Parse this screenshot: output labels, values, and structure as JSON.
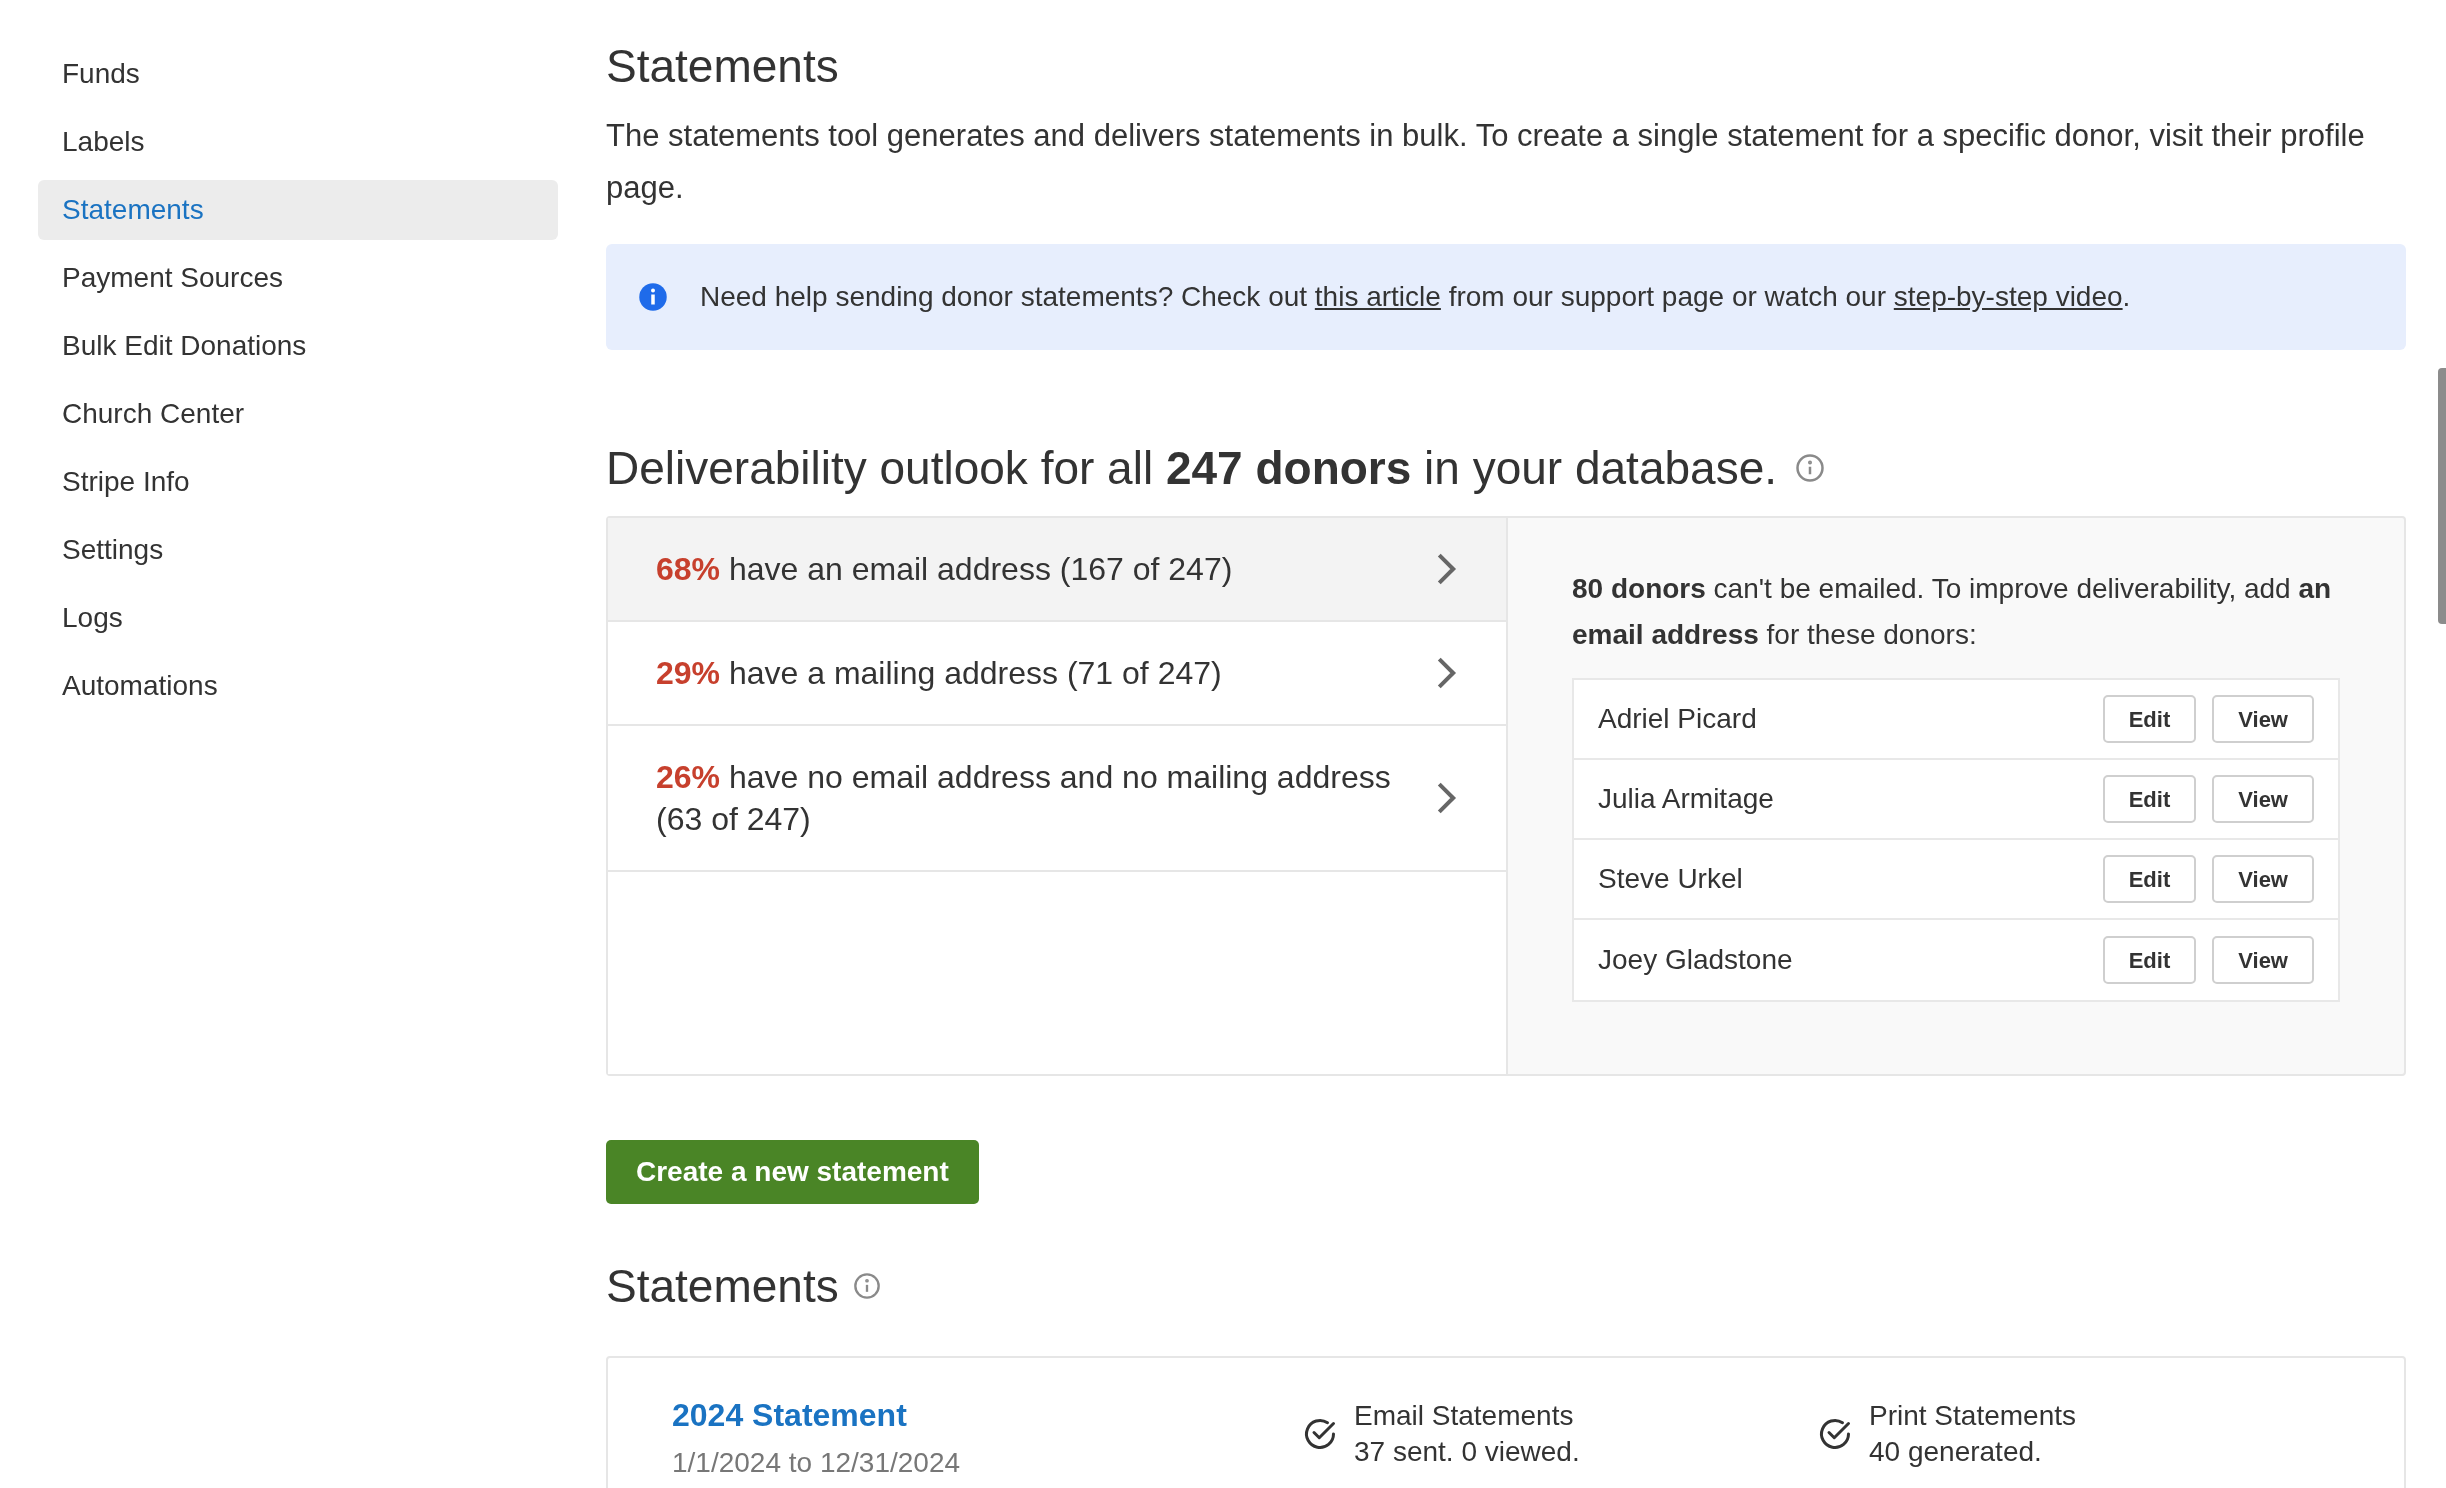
{
  "sidebar": {
    "items": [
      {
        "label": "Funds",
        "selected": false
      },
      {
        "label": "Labels",
        "selected": false
      },
      {
        "label": "Statements",
        "selected": true
      },
      {
        "label": "Payment Sources",
        "selected": false
      },
      {
        "label": "Bulk Edit Donations",
        "selected": false
      },
      {
        "label": "Church Center",
        "selected": false
      },
      {
        "label": "Stripe Info",
        "selected": false
      },
      {
        "label": "Settings",
        "selected": false
      },
      {
        "label": "Logs",
        "selected": false
      },
      {
        "label": "Automations",
        "selected": false
      }
    ]
  },
  "page": {
    "title": "Statements",
    "description": "The statements tool generates and delivers statements in bulk. To create a single statement for a specific donor, visit their profile page."
  },
  "help_banner": {
    "before": "Need help sending donor statements? Check out ",
    "link_1": "this article",
    "middle": " from our support page or watch our ",
    "link_2": "step-by-step video",
    "after": "."
  },
  "deliverability": {
    "heading": "Deliverability outlook for all **247 donors** in your database.",
    "rows": [
      {
        "percent": "68%",
        "text": "have an email address (167 of 247)",
        "selected": true
      },
      {
        "percent": "29%",
        "text": "have a mailing address (71 of 247)",
        "selected": false
      },
      {
        "percent": "26%",
        "text": "have no email address and no mailing address (63 of 247)",
        "selected": false
      }
    ],
    "detail_text": "**80 donors** can't be emailed. To improve deliverability, add **an email address** for these donors:",
    "donors": [
      {
        "name": "Adriel Picard",
        "buttons": [
          "Edit",
          "View"
        ]
      },
      {
        "name": "Julia Armitage",
        "buttons": [
          "Edit",
          "View"
        ]
      },
      {
        "name": "Steve Urkel",
        "buttons": [
          "Edit",
          "View"
        ]
      },
      {
        "name": "Joey Gladstone",
        "buttons": [
          "Edit",
          "View"
        ]
      }
    ]
  },
  "create_button": "Create a new statement",
  "statements": {
    "heading": "Statements",
    "items": [
      {
        "title": "2024 Statement",
        "range": "1/1/2024 to 12/31/2024",
        "email_label": "Email Statements",
        "email_status": "37 sent. 0 viewed.",
        "print_label": "Print Statements",
        "print_status": "40 generated."
      }
    ]
  }
}
